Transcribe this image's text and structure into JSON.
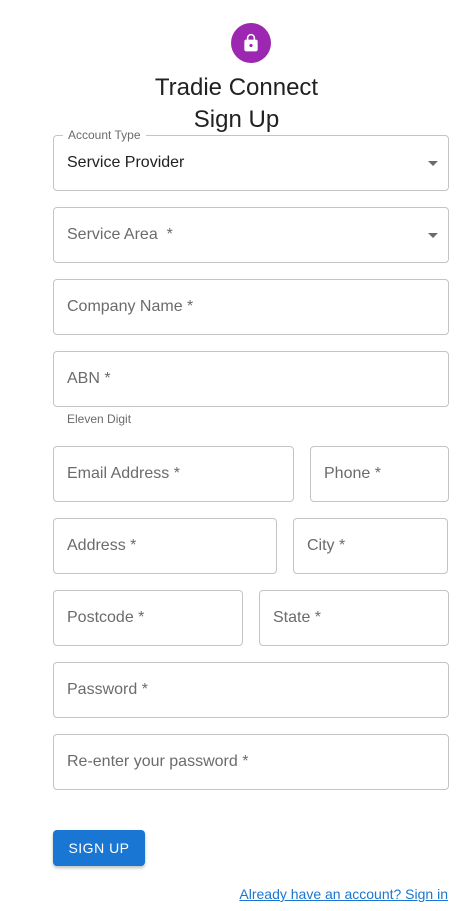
{
  "header": {
    "icon": "lock-icon",
    "accent_color": "#9c27b0",
    "title_line1": "Tradie Connect",
    "title_line2": "Sign Up"
  },
  "form": {
    "account_type": {
      "label": "Account Type",
      "value": "Service Provider"
    },
    "service_area": {
      "placeholder": "Service Area  *"
    },
    "company_name": {
      "placeholder": "Company Name *"
    },
    "abn": {
      "placeholder": "ABN *",
      "helper": "Eleven Digit"
    },
    "email": {
      "placeholder": "Email Address *"
    },
    "phone": {
      "placeholder": "Phone *"
    },
    "address": {
      "placeholder": "Address *"
    },
    "city": {
      "placeholder": "City *"
    },
    "postcode": {
      "placeholder": "Postcode *"
    },
    "state": {
      "placeholder": "State *"
    },
    "password": {
      "placeholder": "Password *"
    },
    "confirm_password": {
      "placeholder": "Re-enter your password *"
    }
  },
  "actions": {
    "submit_label": "SIGN UP",
    "button_color": "#1976d2",
    "signin_link": "Already have an account? Sign in"
  }
}
